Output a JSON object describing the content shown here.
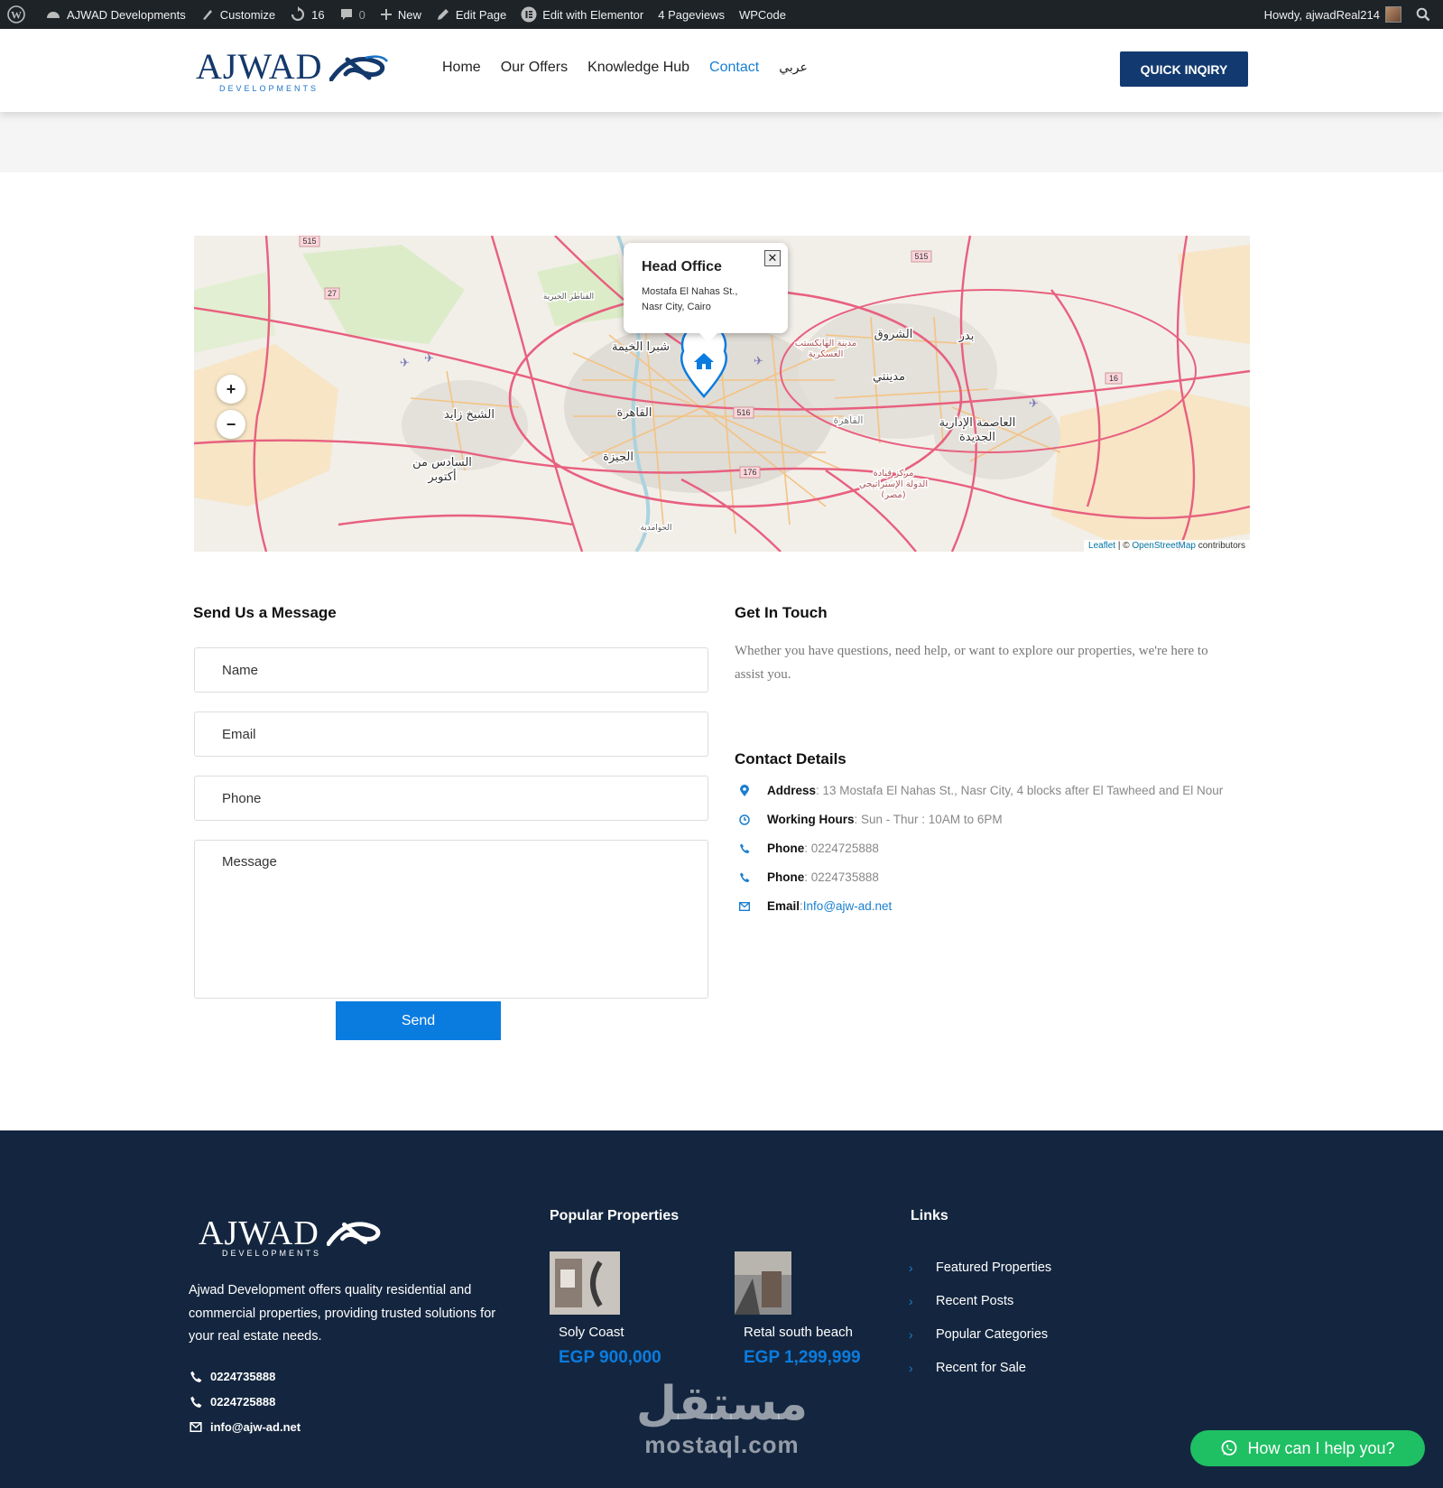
{
  "admin_bar": {
    "site_name": "AJWAD Developments",
    "customize": "Customize",
    "updates_count": "16",
    "comments_count": "0",
    "new": "New",
    "edit_page": "Edit Page",
    "edit_elementor": "Edit with Elementor",
    "pageviews": "4 Pageviews",
    "wpcode": "WPCode",
    "howdy": "Howdy, ajwadReal214"
  },
  "header": {
    "logo_word": "AJWAD",
    "logo_sub": "DEVELOPMENTS",
    "nav": [
      "Home",
      "Our Offers",
      "Knowledge Hub",
      "Contact",
      "عربي"
    ],
    "active_nav": "Contact",
    "quick_inquiry": "QUICK INQIRY"
  },
  "map": {
    "popup_title": "Head Office",
    "popup_address_line1": "Mostafa El Nahas St.,",
    "popup_address_line2": "Nasr City, Cairo",
    "zoom_in": "+",
    "zoom_out": "−",
    "attribution_leaflet": "Leaflet",
    "attribution_sep": " | © ",
    "attribution_osm": "OpenStreetMap",
    "attribution_tail": " contributors",
    "labels": [
      "شبرا الخيمة",
      "القاهرة",
      "الجيزة",
      "الشيخ زايد",
      "السادس من",
      "أكتوبر",
      "الشروق",
      "مدينتي",
      "بدر",
      "العاصمة الإدارية",
      "الجديدة",
      "القاهرة",
      "مدينة الهايكستب",
      "العسكرية",
      "مركز قيادة",
      "الدولة الإستراتيجي",
      "(مصر)",
      "القناطر الخيرية",
      "الحوامدية"
    ],
    "road_numbers": [
      "515",
      "27",
      "515",
      "16",
      "516",
      "176"
    ],
    "colors": {
      "land": "#f2efe9",
      "road_major": "#e8607f",
      "road_minor": "#f3c383",
      "marker": "#0a7ce0"
    }
  },
  "form": {
    "heading": "Send Us a Message",
    "name_placeholder": "Name",
    "email_placeholder": "Email",
    "phone_placeholder": "Phone",
    "message_placeholder": "Message",
    "send_label": "Send"
  },
  "touch": {
    "heading": "Get In Touch",
    "text": "Whether you have questions, need help, or want to explore our properties, we're here to assist you."
  },
  "details": {
    "heading": "Contact Details",
    "address_label": "Address",
    "address_value": ": 13 Mostafa El Nahas St., Nasr City, 4 blocks after El Tawheed and El Nour",
    "hours_label": "Working Hours",
    "hours_value": ": Sun - Thur : 10AM to 6PM",
    "phone1_label": "Phone",
    "phone1_value": ": 0224725888",
    "phone2_label": "Phone",
    "phone2_value": ": 0224735888",
    "email_label": "Email",
    "email_sep": ": ",
    "email_value": "Info@ajw-ad.net"
  },
  "footer": {
    "logo_word": "AJWAD",
    "logo_sub": "DEVELOPMENTS",
    "about": "Ajwad Development offers quality residential and commercial properties, providing trusted solutions for your real estate needs.",
    "phone1": "0224735888",
    "phone2": "0224725888",
    "email": "info@ajw-ad.net",
    "popular_heading": "Popular Properties",
    "properties": [
      {
        "name": "Soly Coast",
        "price": "EGP 900,000"
      },
      {
        "name": "Retal south beach",
        "price": "EGP 1,299,999"
      }
    ],
    "links_heading": "Links",
    "links": [
      "Featured Properties",
      "Recent Posts",
      "Popular Categories",
      "Recent for Sale"
    ],
    "watermark_ar": "مستقل",
    "watermark_en": "mostaql.com",
    "whatsapp": "How can I help you?"
  }
}
